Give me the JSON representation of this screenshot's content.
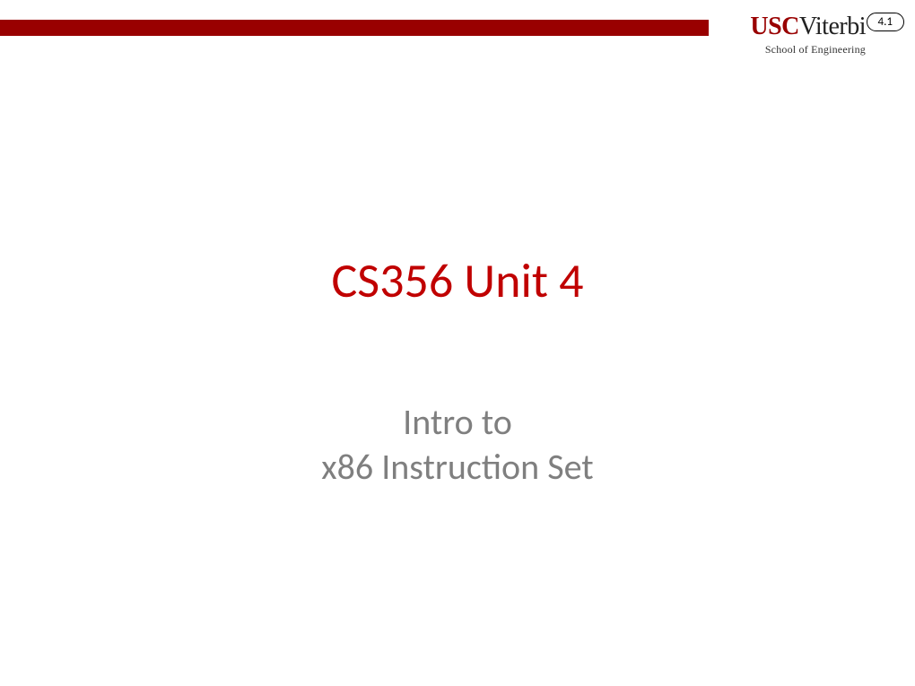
{
  "header": {
    "page_number": "4.1",
    "logo": {
      "usc": "USC",
      "viterbi": "Viterbi",
      "subtitle": "School of Engineering"
    }
  },
  "content": {
    "title": "CS356 Unit 4",
    "subtitle_line1": "Intro to",
    "subtitle_line2": "x86 Instruction Set"
  }
}
